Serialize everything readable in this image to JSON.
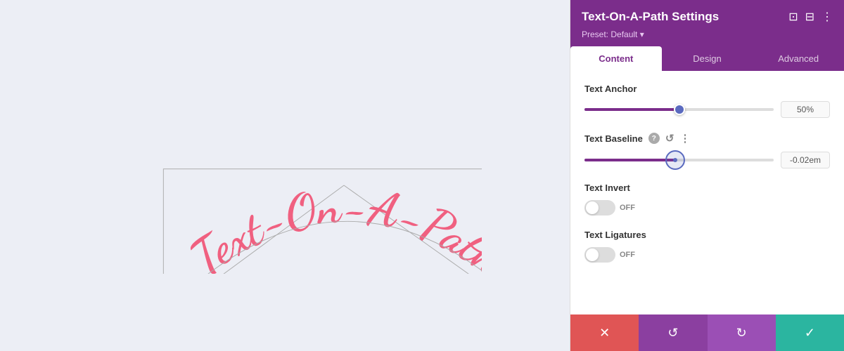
{
  "canvas": {
    "text": "Text-On-A-Path"
  },
  "panel": {
    "title": "Text-On-A-Path Settings",
    "preset_label": "Preset: Default",
    "preset_arrow": "▾",
    "tabs": [
      {
        "id": "content",
        "label": "Content",
        "active": true
      },
      {
        "id": "design",
        "label": "Design",
        "active": false
      },
      {
        "id": "advanced",
        "label": "Advanced",
        "active": false
      }
    ],
    "settings": {
      "text_anchor": {
        "label": "Text Anchor",
        "value": "50%",
        "slider_pct": 50
      },
      "text_baseline": {
        "label": "Text Baseline",
        "value": "-0.02em",
        "slider_pct": 48
      },
      "text_invert": {
        "label": "Text Invert",
        "toggle_state": "OFF"
      },
      "text_ligatures": {
        "label": "Text Ligatures",
        "toggle_state": "OFF"
      }
    },
    "footer": {
      "cancel_icon": "✕",
      "reset_icon": "↺",
      "redo_icon": "↻",
      "save_icon": "✓"
    }
  }
}
